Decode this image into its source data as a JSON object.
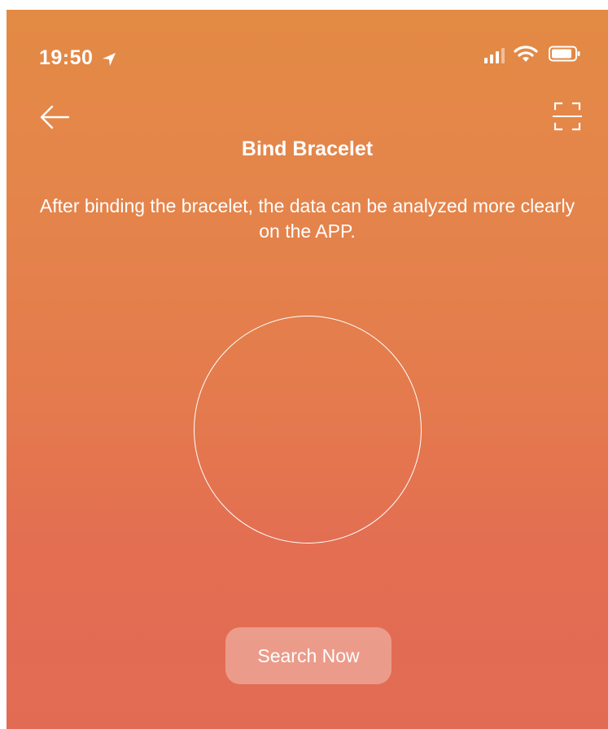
{
  "status_bar": {
    "time": "19:50",
    "icons": [
      "location-arrow-icon",
      "cellular-signal-icon",
      "wifi-icon",
      "battery-icon"
    ]
  },
  "nav": {
    "back_icon": "arrow-left-icon",
    "scan_icon": "scan-icon"
  },
  "page": {
    "title": "Bind Bracelet",
    "description": "After binding the bracelet, the data can be analyzed more clearly on the APP."
  },
  "action": {
    "search_label": "Search Now"
  },
  "colors": {
    "gradient_top": "#e38a44",
    "gradient_bottom": "#e26b54",
    "foreground": "#ffffff"
  }
}
